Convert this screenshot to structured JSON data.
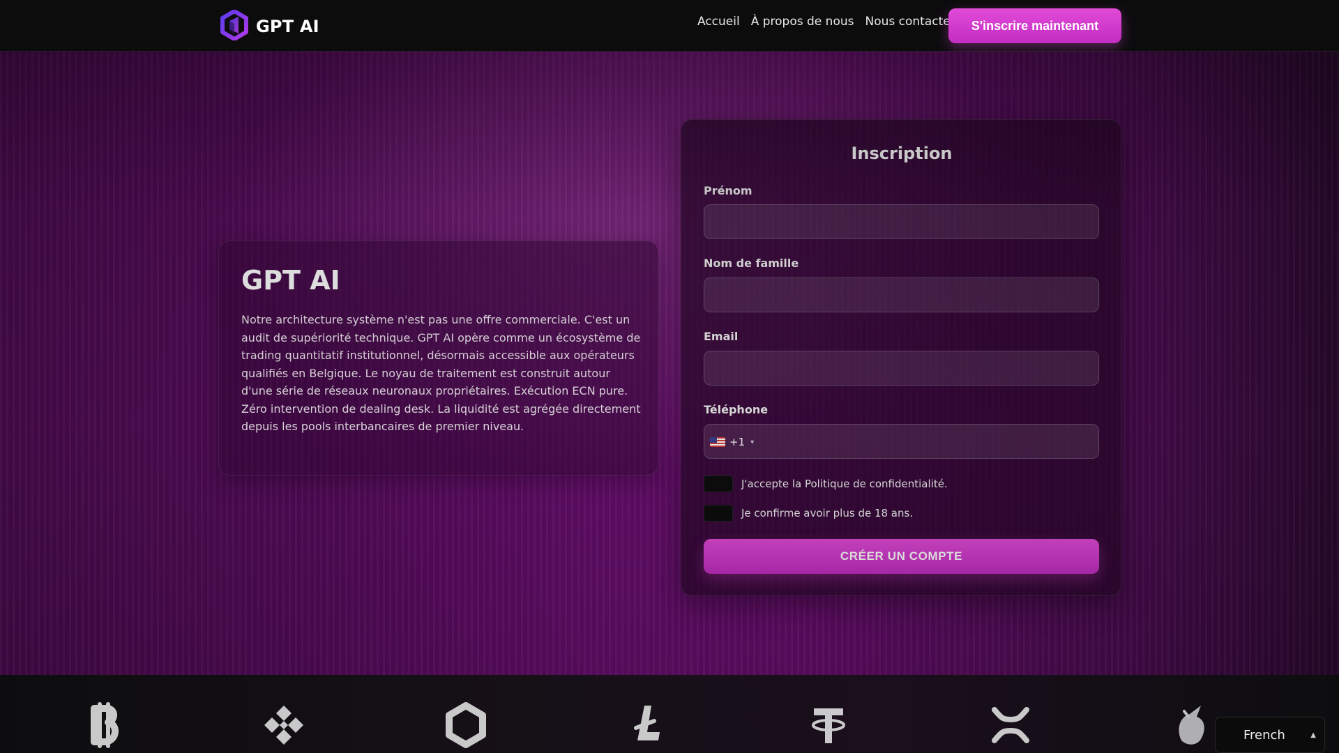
{
  "header": {
    "brand_name": "GPT AI",
    "nav": {
      "home": "Accueil",
      "about": "À propos de nous",
      "contact": "Nous contacter"
    },
    "signup_button": "S'inscrire maintenant"
  },
  "info": {
    "title": "GPT AI",
    "text": "Notre architecture système n'est pas une offre commerciale. C'est un audit de supériorité technique. GPT AI opère comme un écosystème de trading quantitatif institutionnel, désormais accessible aux opérateurs qualifiés en Belgique. Le noyau de traitement est construit autour d'une série de réseaux neuronaux propriétaires. Exécution ECN pure. Zéro intervention de dealing desk. La liquidité est agrégée directement depuis les pools interbancaires de premier niveau."
  },
  "form": {
    "title": "Inscription",
    "first_name_label": "Prénom",
    "first_name_value": "",
    "last_name_label": "Nom de famille",
    "last_name_value": "",
    "email_label": "Email",
    "email_value": "",
    "phone_label": "Téléphone",
    "phone_country_code": "+1",
    "phone_value": "",
    "privacy_check_label": "J'accepte la Politique de confidentialité.",
    "age_check_label": "Je confirme avoir plus de 18 ans.",
    "submit_label": "CRÉER UN COMPTE"
  },
  "footer": {
    "language_selected": "French",
    "coins": [
      "bitcoin-icon",
      "binance-icon",
      "hexagon-coin-icon",
      "litecoin-icon",
      "tether-icon",
      "xrp-icon",
      "unicorn-icon"
    ]
  },
  "colors": {
    "accent": "#e24ad8",
    "background_dark": "#0c0c0d",
    "hero_purple": "#6b0f72"
  }
}
